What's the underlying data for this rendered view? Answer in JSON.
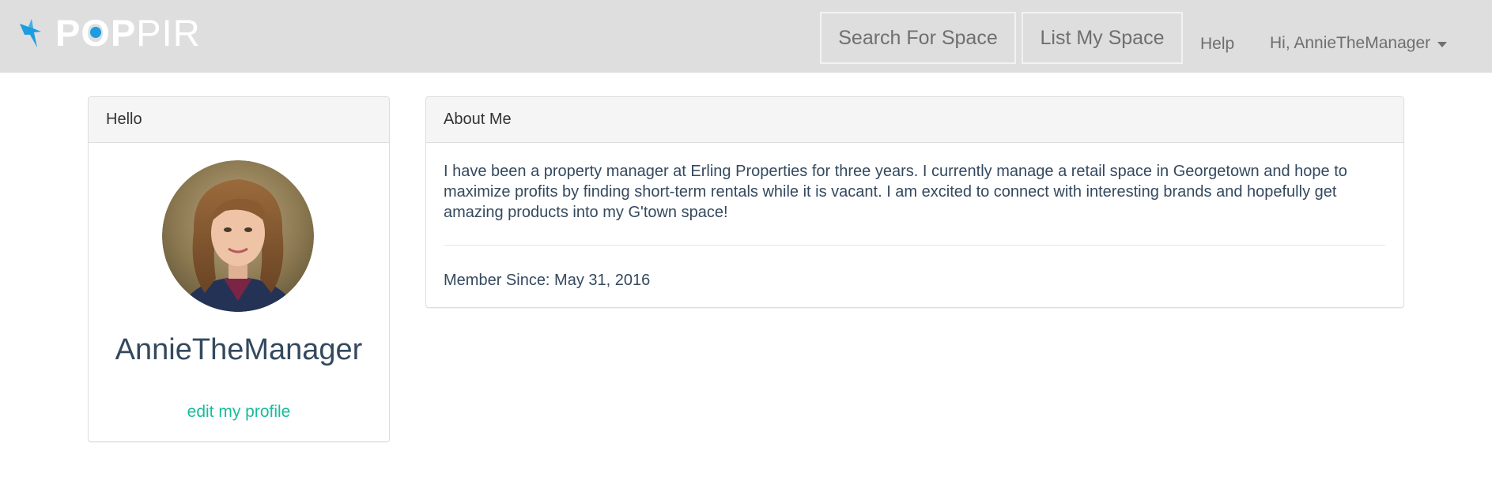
{
  "header": {
    "brand": {
      "prefix": "P",
      "o": "O",
      "mid": "P",
      "suffix": "PIR"
    },
    "search_button": "Search For Space",
    "list_button": "List My Space",
    "help_link": "Help",
    "user_menu": "Hi, AnnieTheManager"
  },
  "hello_panel": {
    "heading": "Hello",
    "username": "AnnieTheManager",
    "edit_link": "edit my profile"
  },
  "about_panel": {
    "heading": "About Me",
    "bio": "I have been a property manager at Erling Properties for three years. I currently manage a retail space in Georgetown and hope to maximize profits by finding short-term rentals while it is vacant. I am excited to connect with interesting brands and hopefully get amazing products into my G'town space!",
    "member_since": "Member Since: May 31, 2016"
  },
  "colors": {
    "navbar_bg": "#dedede",
    "brand_blue": "#1e9ce0",
    "link_teal": "#1abc9c",
    "text_dark": "#34495e"
  },
  "icons": {
    "brand": "hummingbird-logo-icon",
    "user_menu": "caret-down-icon"
  }
}
